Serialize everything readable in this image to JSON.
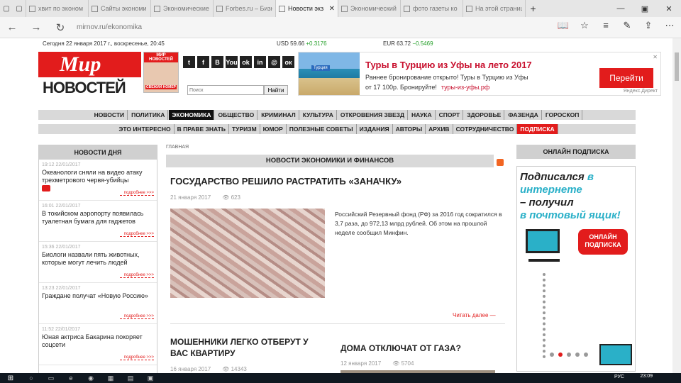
{
  "browser": {
    "tabs": [
      {
        "title": "хвит по эконом",
        "active": false
      },
      {
        "title": "Сайты экономи",
        "active": false
      },
      {
        "title": "Экономические",
        "active": false
      },
      {
        "title": "Forbes.ru – Бизн",
        "active": false
      },
      {
        "title": "Новости экз",
        "active": true
      },
      {
        "title": "Экономический",
        "active": false
      },
      {
        "title": "фото газеты ко",
        "active": false
      },
      {
        "title": "На этой страниц",
        "active": false
      }
    ],
    "url": "mirnov.ru/ekonomika"
  },
  "ticker": {
    "date": "Сегодня 22 января 2017 г., воскресенье, 20:45",
    "usd_label": "USD 59.66",
    "usd_change": "+0.3176",
    "eur_label": "EUR 63.72",
    "eur_change": "−0.5469"
  },
  "logo": {
    "line1": "Мир",
    "line2": "НОВОСТЕЙ"
  },
  "magazine": {
    "top": "МИР НОВОСТЕЙ",
    "badge": "СВЕЖИЙ НОМЕР"
  },
  "social": [
    "t",
    "f",
    "B",
    "You",
    "ok",
    "in",
    "@",
    "ок"
  ],
  "search": {
    "placeholder": "Поиск",
    "button": "Найти"
  },
  "ad": {
    "badge": "Турция",
    "title": "Туры в Турцию из Уфы на лето 2017",
    "line1": "Раннее бронирование открыто! Туры в Турцию из Уфы",
    "line2": "от 17 100р. Бронируйте!",
    "link": "туры-из-уфы.рф",
    "button": "Перейти",
    "source": "Яндекс.Директ"
  },
  "menu_primary": [
    "НОВОСТИ",
    "ПОЛИТИКА",
    "ЭКОНОМИКА",
    "ОБЩЕСТВО",
    "КРИМИНАЛ",
    "КУЛЬТУРА",
    "ОТКРОВЕНИЯ ЗВЕЗД",
    "НАУКА",
    "СПОРТ",
    "ЗДОРОВЬЕ",
    "ФАЗЕНДА",
    "ГОРОСКОП"
  ],
  "menu_secondary": [
    "ЭТО ИНТЕРЕСНО",
    "В ПРАВЕ ЗНАТЬ",
    "ТУРИЗМ",
    "ЮМОР",
    "ПОЛЕЗНЫЕ СОВЕТЫ",
    "ИЗДАНИЯ",
    "АВТОРЫ",
    "АРХИВ",
    "СОТРУДНИЧЕСТВО",
    "ПОДПИСКА"
  ],
  "left_panel": {
    "title": "НОВОСТИ ДНЯ",
    "more": "подробнее >>>",
    "items": [
      {
        "time": "19:12 22/01/2017",
        "headline": "Океанологи сняли на видео атаку трехметрового червя-убийцы"
      },
      {
        "time": "16:01 22/01/2017",
        "headline": "В токийском аэропорту появилась туалетная бумага для гаджетов"
      },
      {
        "time": "15:36 22/01/2017",
        "headline": "Биологи назвали пять животных, которые могут лечить людей"
      },
      {
        "time": "13:23 22/01/2017",
        "headline": "Граждане получат «Новую Россию»"
      },
      {
        "time": "11:52 22/01/2017",
        "headline": "Юная актриса Бакарина покоряет соцсети"
      }
    ]
  },
  "center": {
    "breadcrumb": "ГЛАВНАЯ",
    "section": "НОВОСТИ ЭКОНОМИКИ И ФИНАНСОВ",
    "article1": {
      "title": "ГОСУДАРСТВО РЕШИЛО РАСТРАТИТЬ «ЗАНАЧКУ»",
      "date": "21 января 2017",
      "views": "623",
      "text": "Российский Резервный фонд (РФ) за 2016 год сократился в 3,7 раза, до 972,13 млрд рублей. Об этом на прошлой неделе сообщил Минфин.",
      "more": "Читать далее —"
    },
    "article2": {
      "title": "МОШЕННИКИ ЛЕГКО ОТБЕРУТ У ВАС КВАРТИРУ",
      "date": "16 января 2017",
      "views": "14343"
    },
    "article3": {
      "title": "ДОМА ОТКЛЮЧАТ ОТ ГАЗА?",
      "date": "12 января 2017",
      "views": "5704"
    }
  },
  "right_panel": {
    "title": "ОНЛАЙН ПОДПИСКА",
    "promo_a": "Подписался",
    "promo_b": "в интернете",
    "promo_c": "– получил",
    "promo_d": "в почтовый ящик!",
    "button": "ОНЛАЙН ПОДПИСКА"
  },
  "taskbar": {
    "lang": "РУС",
    "time": "23:09"
  }
}
